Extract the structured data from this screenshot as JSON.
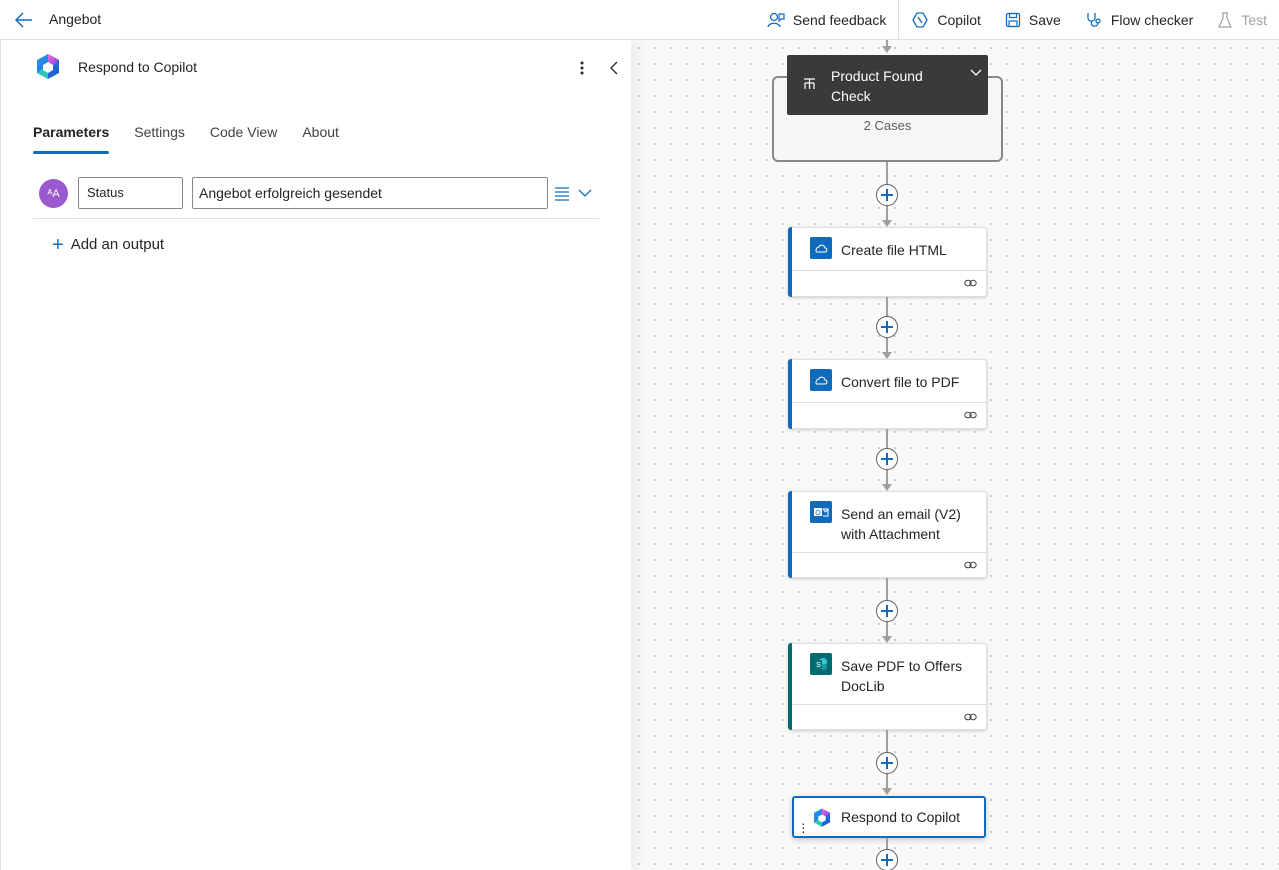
{
  "topbar": {
    "title": "Angebot",
    "actions": {
      "send_feedback": "Send feedback",
      "copilot": "Copilot",
      "save": "Save",
      "flow_checker": "Flow checker",
      "test": "Test"
    }
  },
  "panel": {
    "title": "Respond to Copilot",
    "tabs": [
      "Parameters",
      "Settings",
      "Code View",
      "About"
    ],
    "active_tab": "Parameters",
    "output": {
      "avatar_text": "ᴬA",
      "name": "Status",
      "value": "Angebot erfolgreich gesendet"
    },
    "add_output_label": "Add an output"
  },
  "flow": {
    "switch": {
      "title": "Product Found Check",
      "cases": "2 Cases"
    },
    "cards": [
      {
        "title": "Create file HTML",
        "icon": "onedrive-icon",
        "color": "#0f6cbd"
      },
      {
        "title": "Convert file to PDF",
        "icon": "onedrive-icon",
        "color": "#0f6cbd"
      },
      {
        "title": "Send an email (V2) with Attachment",
        "icon": "outlook-icon",
        "color": "#0f6cbd"
      },
      {
        "title": "Save PDF to Offers DocLib",
        "icon": "sharepoint-icon",
        "color": "#036c70"
      }
    ],
    "selected": {
      "title": "Respond to Copilot",
      "icon": "copilot-icon"
    }
  }
}
